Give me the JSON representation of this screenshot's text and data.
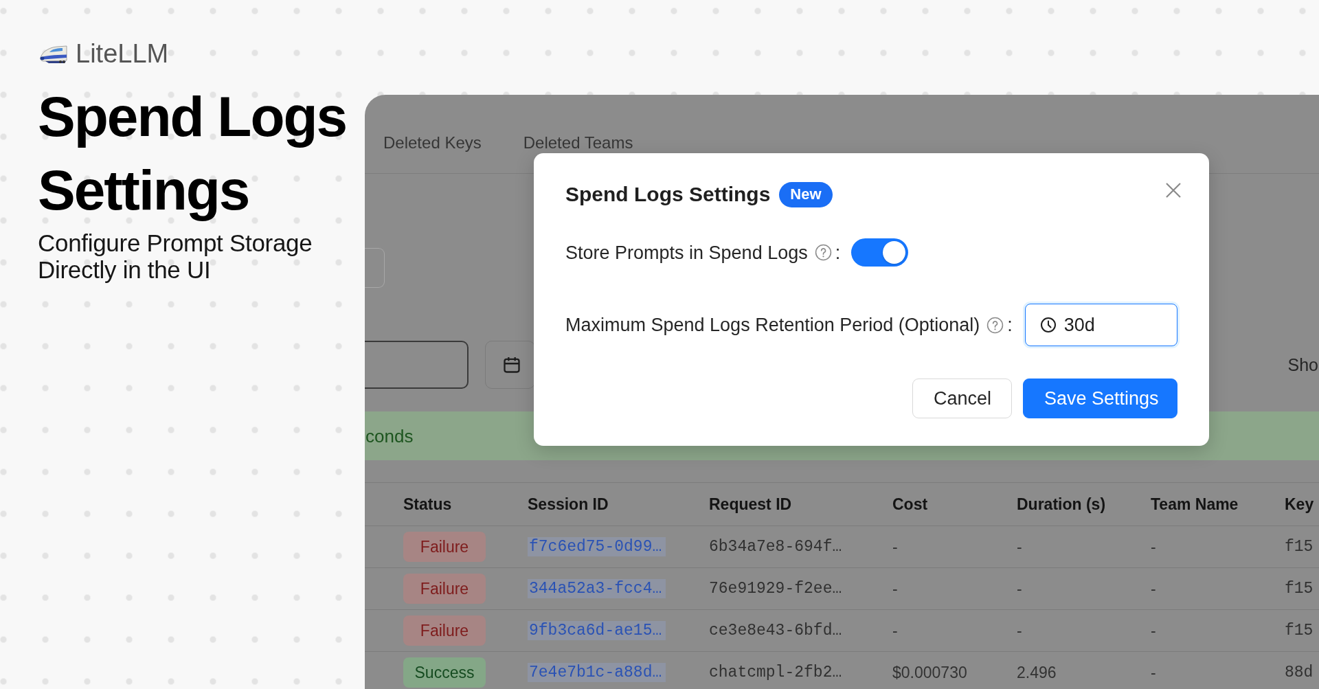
{
  "brand": {
    "name": "LiteLLM"
  },
  "hero": {
    "title": "Spend Logs Settings",
    "subtitle": "Configure Prompt Storage Directly in the UI"
  },
  "app": {
    "tabs": [
      {
        "label": "Deleted Keys",
        "selected": false
      },
      {
        "label": "Deleted Teams",
        "selected": false
      }
    ],
    "toolbar": {
      "side_text": "Sho"
    },
    "banner": {
      "text": "conds"
    },
    "table": {
      "columns": [
        "Status",
        "Session ID",
        "Request ID",
        "Cost",
        "Duration (s)",
        "Team Name",
        "Key"
      ],
      "rows": [
        {
          "status": {
            "label": "Failure",
            "kind": "failure"
          },
          "session_id": "f7c6ed75-0d99…",
          "request_id": "6b34a7e8-694f…",
          "cost": "-",
          "duration": "-",
          "team_name": "-",
          "key": "f15"
        },
        {
          "status": {
            "label": "Failure",
            "kind": "failure"
          },
          "session_id": "344a52a3-fcc4…",
          "request_id": "76e91929-f2ee…",
          "cost": "-",
          "duration": "-",
          "team_name": "-",
          "key": "f15"
        },
        {
          "status": {
            "label": "Failure",
            "kind": "failure"
          },
          "session_id": "9fb3ca6d-ae15…",
          "request_id": "ce3e8e43-6bfd…",
          "cost": "-",
          "duration": "-",
          "team_name": "-",
          "key": "f15"
        },
        {
          "status": {
            "label": "Success",
            "kind": "success"
          },
          "session_id": "7e4e7b1c-a88d…",
          "request_id": "chatcmpl-2fb2…",
          "cost": "$0.000730",
          "duration": "2.496",
          "team_name": "-",
          "key": "88d"
        }
      ]
    }
  },
  "dialog": {
    "title": "Spend Logs Settings",
    "badge": "New",
    "fields": [
      {
        "kind": "switch",
        "label": "Store Prompts in Spend Logs",
        "suffix": ":",
        "on": true
      },
      {
        "kind": "input",
        "label": "Maximum Spend Logs Retention Period (Optional)",
        "suffix": ":",
        "value": "30d"
      }
    ],
    "buttons": [
      {
        "label": "Cancel",
        "kind": "default"
      },
      {
        "label": "Save Settings",
        "kind": "primary"
      }
    ]
  }
}
